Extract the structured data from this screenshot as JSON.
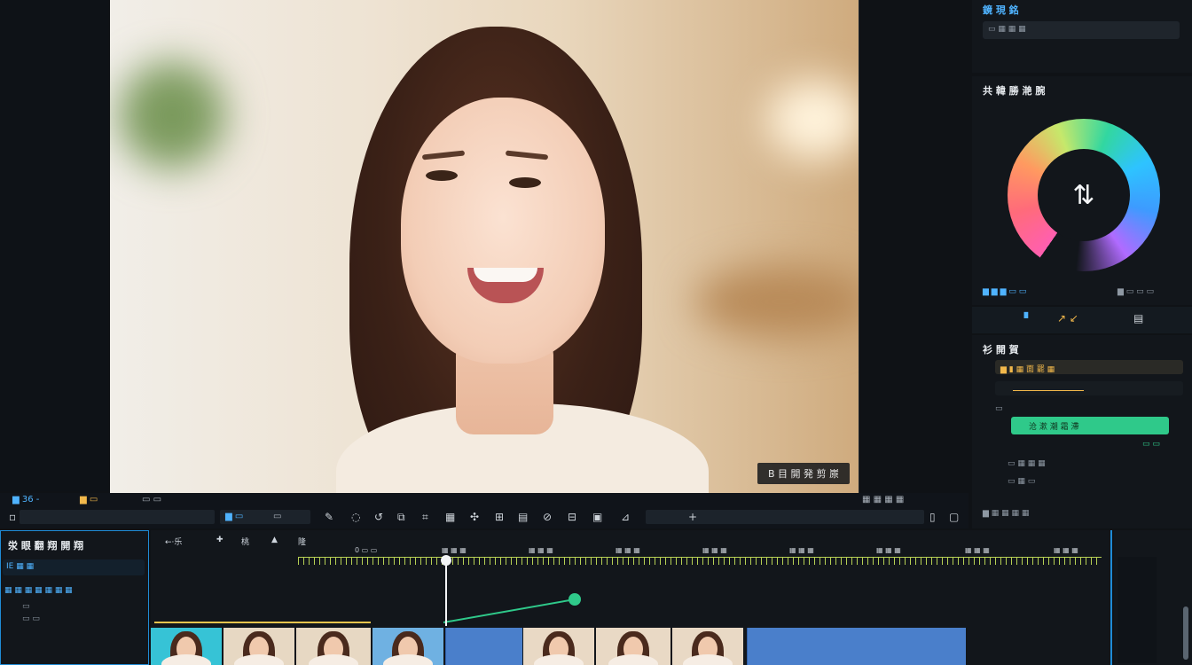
{
  "preview": {
    "caption": "B 目 開 発 剪 㟶"
  },
  "preview_controls": {
    "left_label_1": "▆ 36 -",
    "left_label_2": "▆ ▭",
    "left_label_3": "▭ ▭",
    "track_label_1": "▆ ▭",
    "track_label_2": "▭",
    "right_label": "▦ ▦ ▦ ▦"
  },
  "right_top": {
    "title": "鏡 現 銘",
    "field_text": "▭ ▦ ▦ ▦"
  },
  "color_panel": {
    "title": "共 韓 勝 滟 腕",
    "center_icon": "⇅",
    "left_row": "▆ ▆ ▆ ▭ ▭",
    "right_row": "▆ ▭ ▭ ▭"
  },
  "right_tabs": {
    "tab_1": "▝",
    "tab_2": "↗ ↙",
    "tab_3": "▤"
  },
  "properties": {
    "title": "衫 開 賀",
    "row_1": "▆ ▮ ▦ 面 罷 ▦",
    "row_2_value": "▭",
    "row_3": "▭",
    "highlight_label": "沧 漱 潮 霜 滯",
    "row_5": "▭ ▭",
    "row_6": "▭ ▦ ▦ ▦",
    "row_7": "▭ ▦ ▭",
    "footer": "▆ ▦ ▦ ▦ ▦"
  },
  "timeline_left": {
    "title": "泶 眼 翻 翔 開 翔",
    "row_1": "IE ▦ ▦",
    "row_2": "▦ ▦ ▦ ▦ ▦ ▦ ▦",
    "row_3": "▭",
    "row_4": "▭ ▭"
  },
  "timeline": {
    "tool_1": "←·乐",
    "tool_2": "✚",
    "tool_3": "桃",
    "tool_4": "▲",
    "tool_5": "隆",
    "ticks": [
      "0 ▭ ▭",
      "▦ ▦ ▦",
      "▦ ▦ ▦",
      "▦ ▦ ▦",
      "▦ ▦ ▦",
      "▦ ▦ ▦",
      "▦ ▦ ▦",
      "▦ ▦ ▦",
      "▦ ▦ ▦",
      "▦ ▦ ▦"
    ]
  },
  "colors": {
    "accent_blue": "#1f8bd6",
    "accent_green": "#2fc98a",
    "ruler": "#b6d054",
    "clip_blue": "#4a7fcb"
  }
}
